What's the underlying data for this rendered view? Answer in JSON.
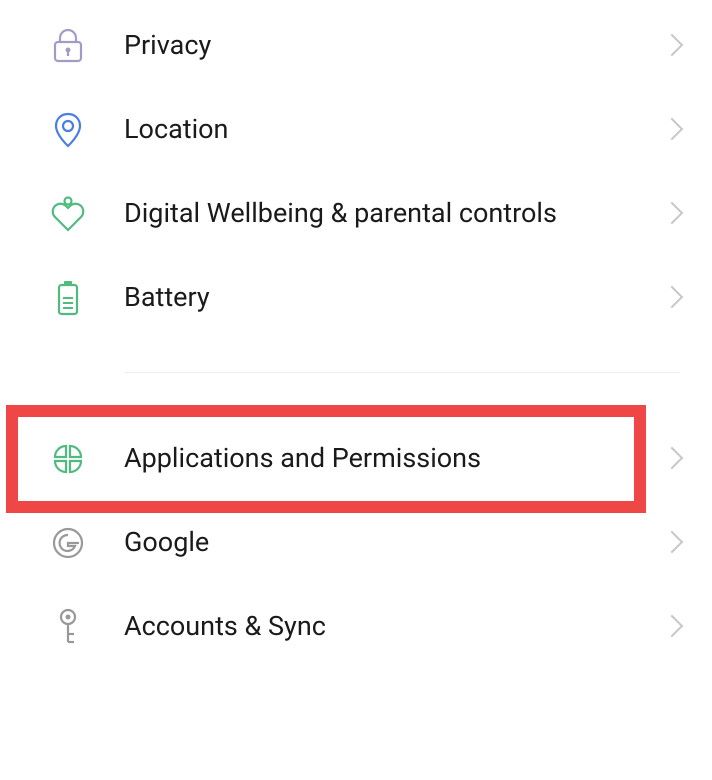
{
  "items": {
    "privacy": {
      "label": "Privacy"
    },
    "location": {
      "label": "Location"
    },
    "wellbeing": {
      "label": "Digital Wellbeing & parental controls"
    },
    "battery": {
      "label": "Battery"
    },
    "apps": {
      "label": "Applications and Permissions"
    },
    "google": {
      "label": "Google"
    },
    "accounts": {
      "label": "Accounts & Sync"
    }
  }
}
